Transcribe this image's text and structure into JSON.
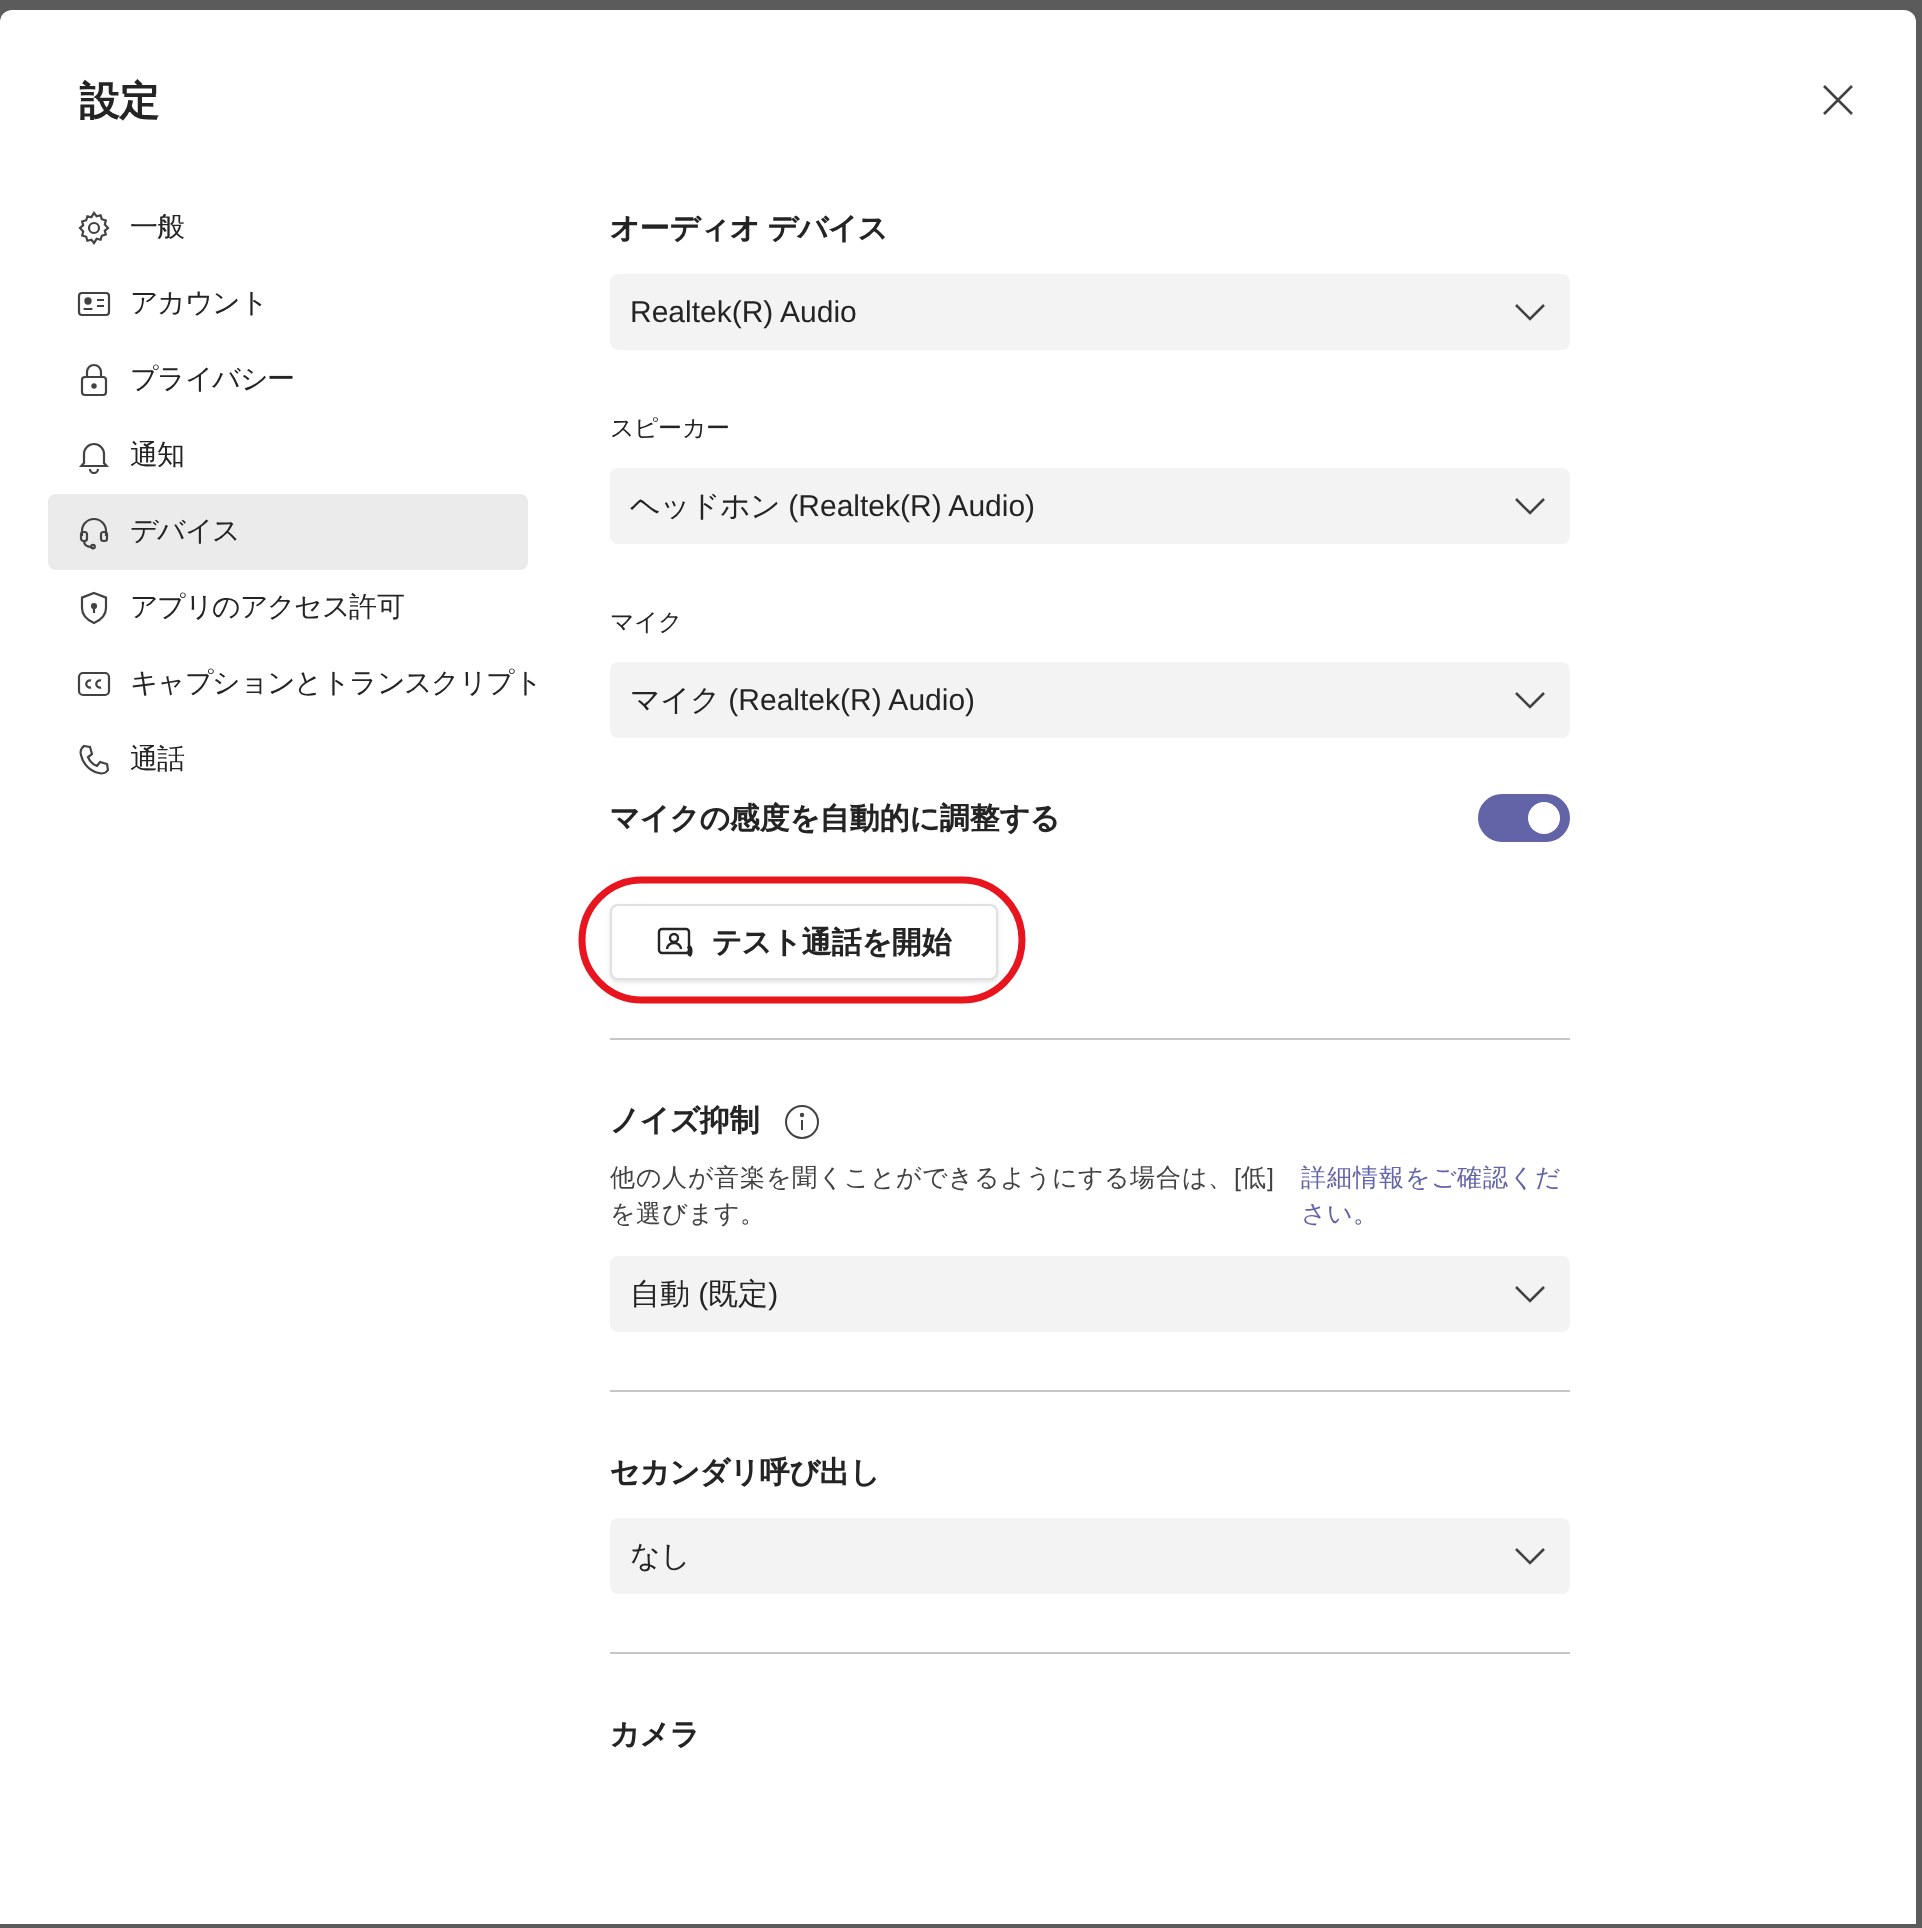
{
  "dialog": {
    "title": "設定"
  },
  "nav": [
    {
      "label": "一般",
      "selected": false
    },
    {
      "label": "アカウント",
      "selected": false
    },
    {
      "label": "プライバシー",
      "selected": false
    },
    {
      "label": "通知",
      "selected": false
    },
    {
      "label": "デバイス",
      "selected": true
    },
    {
      "label": "アプリのアクセス許可",
      "selected": false
    },
    {
      "label": "キャプションとトランスクリプト",
      "selected": false
    },
    {
      "label": "通話",
      "selected": false
    }
  ],
  "sections": [
    {
      "kind": "heading",
      "text": "オーディオ デバイス"
    },
    {
      "kind": "dropdown",
      "value": "Realtek(R) Audio"
    },
    {
      "kind": "label",
      "text": "スピーカー"
    },
    {
      "kind": "dropdown",
      "value": "ヘッドホン (Realtek(R) Audio)"
    },
    {
      "kind": "label",
      "text": "マイク"
    },
    {
      "kind": "dropdown",
      "value": "マイク (Realtek(R) Audio)"
    },
    {
      "kind": "toggle",
      "text": "マイクの感度を自動的に調整する",
      "on": true
    },
    {
      "kind": "button",
      "text": "テスト通話を開始",
      "highlighted": true
    },
    {
      "kind": "divider"
    },
    {
      "kind": "heading",
      "text": "ノイズ抑制",
      "info": true
    },
    {
      "kind": "note",
      "text": "他の人が音楽を聞くことができるようにする場合は、[低] を選びます。",
      "link": "詳細情報をご確認ください。"
    },
    {
      "kind": "dropdown",
      "value": "自動 (既定)"
    },
    {
      "kind": "divider"
    },
    {
      "kind": "heading",
      "text": "セカンダリ呼び出し"
    },
    {
      "kind": "dropdown",
      "value": "なし"
    },
    {
      "kind": "divider"
    },
    {
      "kind": "heading",
      "text": "カメラ"
    }
  ]
}
